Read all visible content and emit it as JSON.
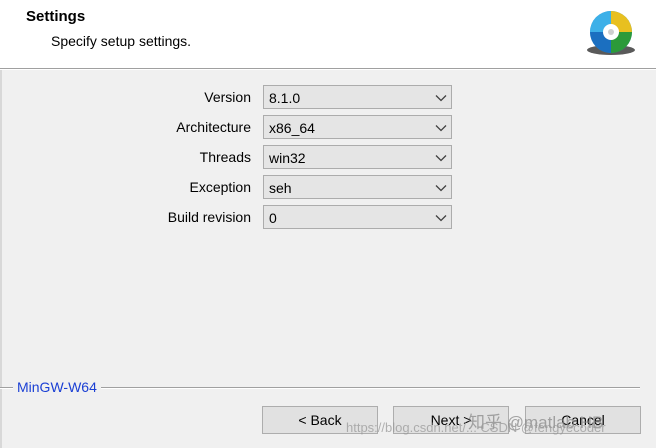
{
  "header": {
    "title": "Settings",
    "subtitle": "Specify setup settings.",
    "icon": "installer-disc-icon"
  },
  "settings": [
    {
      "label": "Version",
      "value": "8.1.0"
    },
    {
      "label": "Architecture",
      "value": "x86_64"
    },
    {
      "label": "Threads",
      "value": "win32"
    },
    {
      "label": "Exception",
      "value": "seh"
    },
    {
      "label": "Build revision",
      "value": "0"
    }
  ],
  "footer": {
    "brand": "MinGW-W64",
    "brand_color": "#1a3fd4",
    "back_label": "< Back",
    "next_label": "Next >",
    "cancel_label": "Cancel"
  },
  "watermarks": {
    "line1": "知乎 @matlab HB",
    "line2": "https://blog.csdn.net/... CSDN @fengyecoder"
  }
}
